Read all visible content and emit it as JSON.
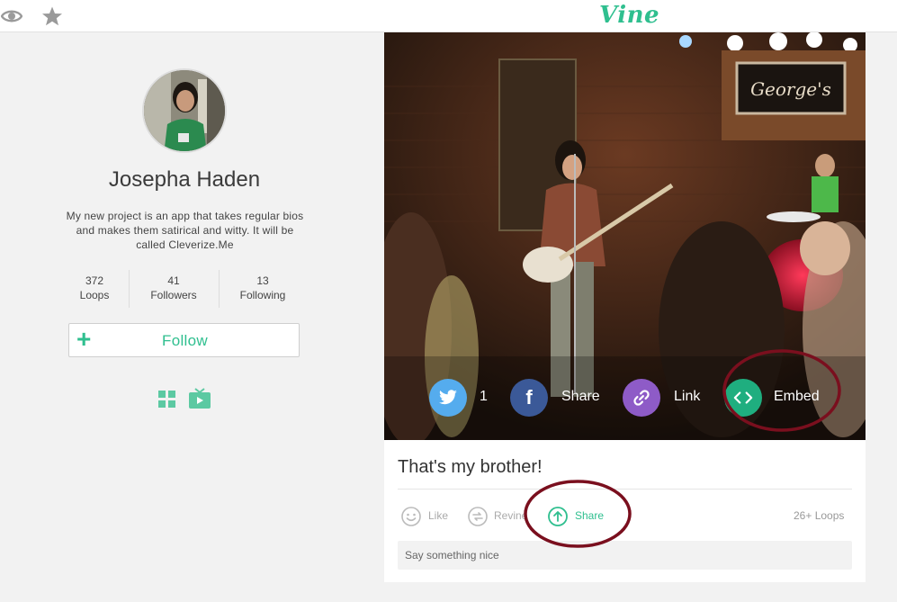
{
  "topbar": {
    "logo": "Vine",
    "icons": [
      "eye-icon",
      "star-icon"
    ]
  },
  "profile": {
    "name": "Josepha Haden",
    "bio": "My new project is an app that takes regular bios and makes them satirical and witty. It will be called Cleverize.Me",
    "stats": [
      {
        "value": "372",
        "label": "Loops"
      },
      {
        "value": "41",
        "label": "Followers"
      },
      {
        "value": "13",
        "label": "Following"
      }
    ],
    "follow_label": "Follow",
    "view_icons": [
      "grid-view-icon",
      "tv-view-icon"
    ]
  },
  "post": {
    "overlay": {
      "twitter_count": "1",
      "facebook_label": "Share",
      "link_label": "Link",
      "embed_label": "Embed"
    },
    "caption": "That's my brother!",
    "actions": {
      "like": "Like",
      "revine": "Revine",
      "share": "Share"
    },
    "loops": "26+ Loops",
    "comment_placeholder": "Say something nice"
  },
  "colors": {
    "brand": "#2fbf8f",
    "twitter": "#55acee",
    "facebook": "#3b5998",
    "link": "#8e5bc7",
    "annotation": "#7a0f1e"
  }
}
